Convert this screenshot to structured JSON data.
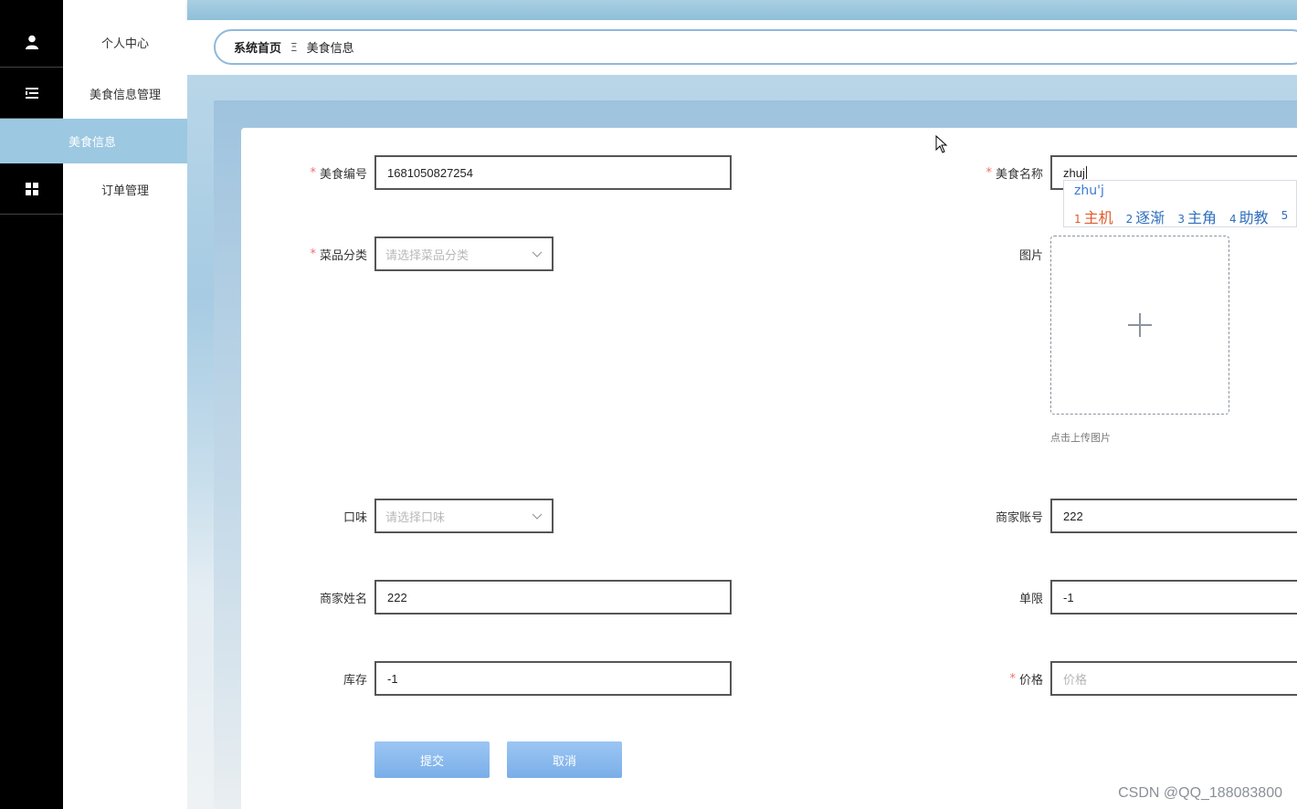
{
  "sidebar": {
    "items": [
      {
        "label": "个人中心",
        "icon": "user-icon"
      },
      {
        "label": "美食信息管理",
        "icon": "list-icon"
      },
      {
        "label": "美食信息",
        "active": true
      },
      {
        "label": "订单管理",
        "icon": "grid-icon"
      }
    ]
  },
  "breadcrumb": {
    "home": "系统首页",
    "separator": "Ξ",
    "current": "美食信息"
  },
  "form": {
    "food_id": {
      "label": "美食编号",
      "required": true,
      "value": "1681050827254"
    },
    "food_name": {
      "label": "美食名称",
      "required": true,
      "value": "zhuj"
    },
    "category": {
      "label": "菜品分类",
      "required": true,
      "placeholder": "请选择菜品分类"
    },
    "image": {
      "label": "图片",
      "hint": "点击上传图片"
    },
    "flavor": {
      "label": "口味",
      "placeholder": "请选择口味"
    },
    "merchant_account": {
      "label": "商家账号",
      "value": "222"
    },
    "merchant_name": {
      "label": "商家姓名",
      "value": "222"
    },
    "limit": {
      "label": "单限",
      "value": "-1"
    },
    "stock": {
      "label": "库存",
      "value": "-1"
    },
    "price": {
      "label": "价格",
      "required": true,
      "placeholder": "价格"
    },
    "submit_label": "提交",
    "cancel_label": "取消"
  },
  "ime": {
    "composition": "zhu'j",
    "candidates": [
      {
        "num": "1",
        "text": "主机"
      },
      {
        "num": "2",
        "text": "逐渐"
      },
      {
        "num": "3",
        "text": "主角"
      },
      {
        "num": "4",
        "text": "助教"
      },
      {
        "num": "5",
        "text": ""
      }
    ]
  },
  "watermark": "CSDN @QQ_188083800",
  "colors": {
    "active_menu": "#9cc8e1",
    "required_star": "#f56c6c",
    "button": "#8ab9ee",
    "ime_first": "#e05a2a",
    "ime_other": "#2f6fbe"
  }
}
